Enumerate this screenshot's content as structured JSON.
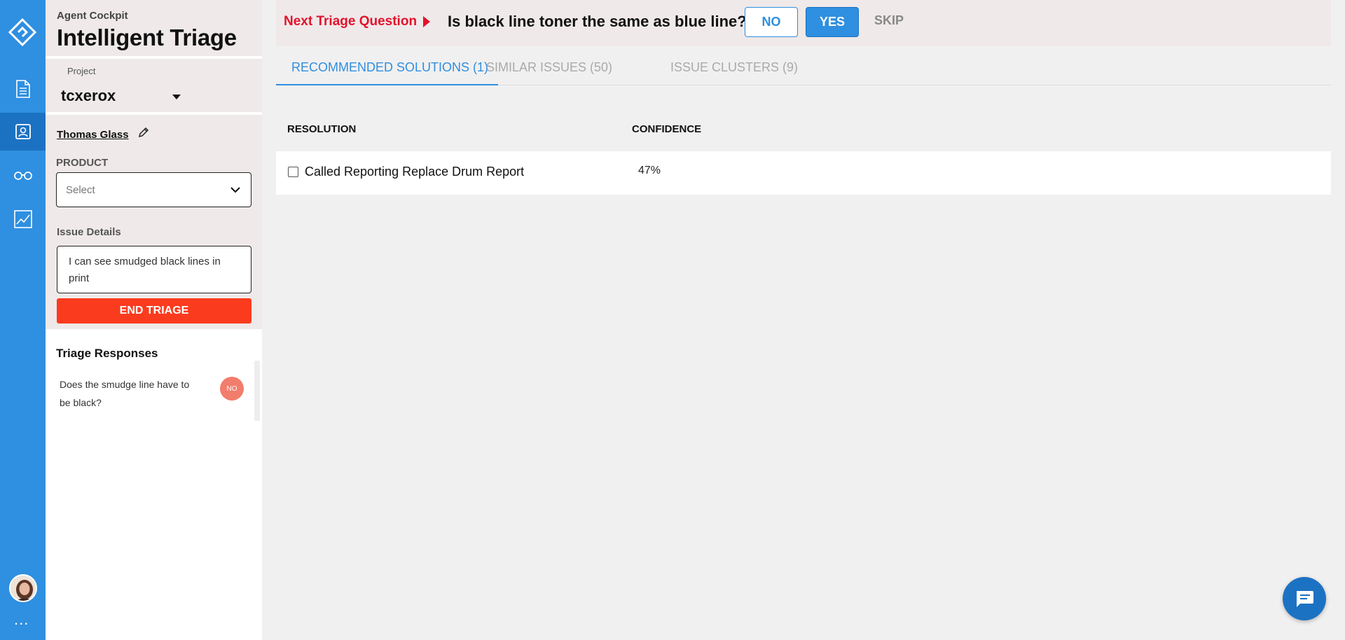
{
  "app": {
    "section": "Agent Cockpit",
    "title": "Intelligent Triage"
  },
  "project": {
    "label": "Project",
    "value": "tcxerox"
  },
  "user": {
    "name": "Thomas Glass"
  },
  "product": {
    "label": "PRODUCT",
    "placeholder": "Select"
  },
  "issue": {
    "label": "Issue Details",
    "text": "I can see smudged black lines in print"
  },
  "end_triage_label": "END TRIAGE",
  "responses": {
    "title": "Triage Responses",
    "items": [
      {
        "question": "Does the smudge line have to be black?",
        "answer": "NO"
      }
    ]
  },
  "question_bar": {
    "prefix": "Next Triage Question",
    "question": "Is black line toner the same as blue line?",
    "no_label": "NO",
    "yes_label": "YES",
    "skip_label": "SKIP"
  },
  "tabs": [
    {
      "label": "RECOMMENDED SOLUTIONS (1)",
      "active": true
    },
    {
      "label": "SIMILAR ISSUES (50)",
      "active": false
    },
    {
      "label": "ISSUE CLUSTERS (9)",
      "active": false
    }
  ],
  "table": {
    "headers": {
      "resolution": "RESOLUTION",
      "confidence": "CONFIDENCE"
    },
    "rows": [
      {
        "resolution": "Called Reporting Replace Drum Report",
        "confidence": "47%"
      }
    ]
  },
  "rail": {
    "more_label": "...",
    "icons": [
      "document-icon",
      "contact-icon",
      "glasses-icon",
      "chart-icon"
    ]
  },
  "colors": {
    "primary": "#2f8fe0",
    "primary_dark": "#1c72c2",
    "danger": "#fb3b1e",
    "accent_red": "#e3122c",
    "badge_no": "#f27d6c"
  }
}
